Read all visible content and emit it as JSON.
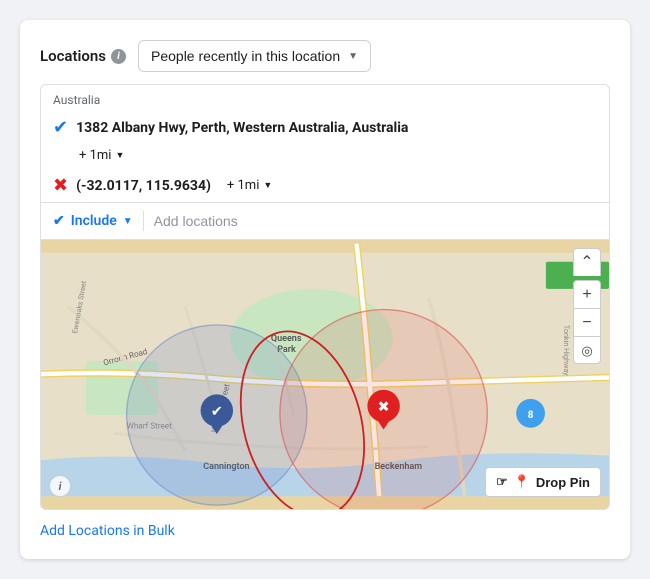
{
  "header": {
    "locations_label": "Locations",
    "info_icon": "i",
    "dropdown_label": "People recently in this location",
    "dropdown_chevron": "▼"
  },
  "location_box": {
    "country": "Australia",
    "primary_location": {
      "name": "1382 Albany Hwy, Perth, Western Australia, Australia",
      "radius": "+ 1mi",
      "pin_icon": "📍"
    },
    "secondary_location": {
      "coords": "(-32.0117, 115.9634)",
      "radius": "+ 1mi"
    }
  },
  "toolbar": {
    "include_label": "Include",
    "chevron": "▼",
    "add_locations_placeholder": "Add locations"
  },
  "map": {
    "drop_pin_label": "Drop Pin",
    "pin_icon": "📍",
    "hand_icon": "☞",
    "zoom_in": "+",
    "zoom_out": "−",
    "chevron_up": "⌃",
    "info": "i",
    "locate": "◎"
  },
  "footer": {
    "add_bulk_label": "Add Locations in Bulk"
  }
}
